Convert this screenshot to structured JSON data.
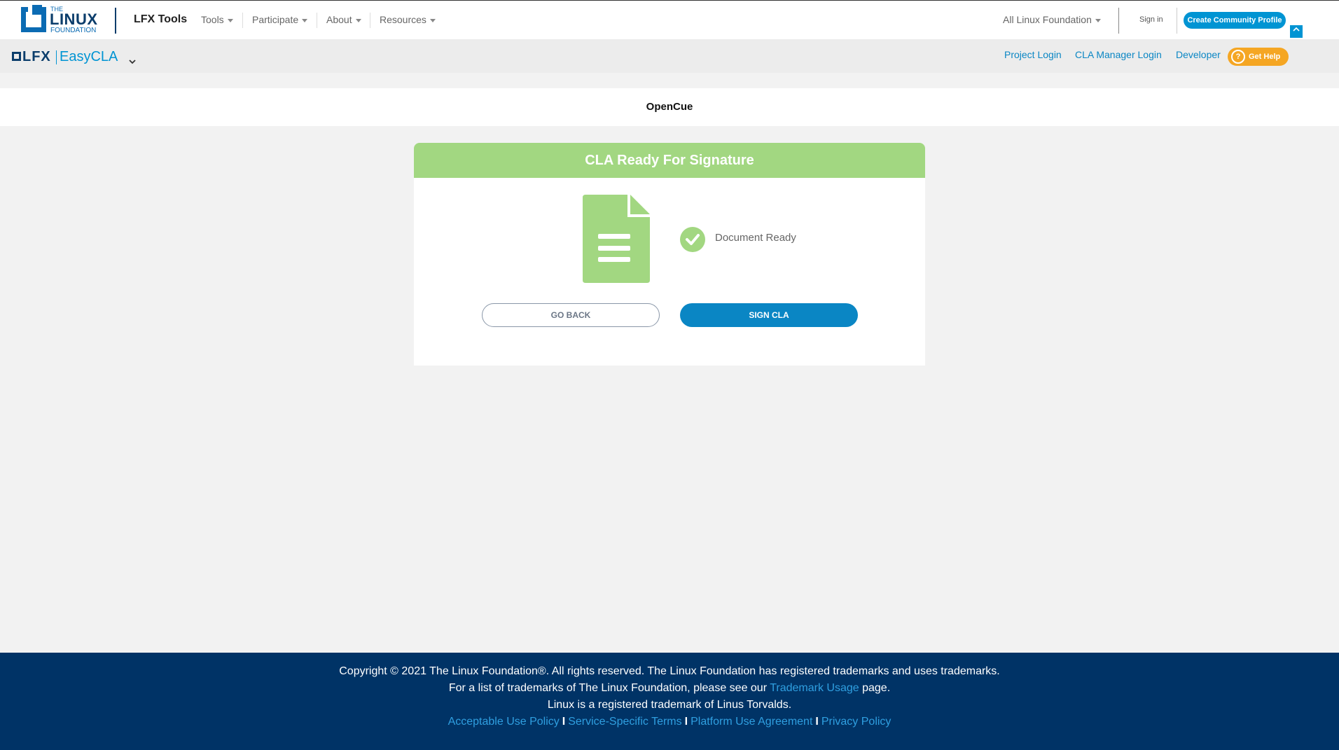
{
  "topbar": {
    "logo": {
      "the": "THE",
      "linux": "LINUX",
      "foundation": "FOUNDATION"
    },
    "product": "LFX Tools",
    "nav": [
      {
        "label": "Tools"
      },
      {
        "label": "Participate"
      },
      {
        "label": "About"
      },
      {
        "label": "Resources"
      }
    ],
    "org_selector": "All Linux Foundation",
    "sign_in": "Sign in",
    "create_profile": "Create Community Profile",
    "collapse_icon": "chevron-up-icon"
  },
  "subbar": {
    "logo": {
      "lfx": "LFX",
      "product": "EasyCLA"
    },
    "dropdown_icon": "chevron-down-icon",
    "links": [
      "Project Login",
      "CLA Manager Login",
      "Developer"
    ],
    "help": "Get Help",
    "help_icon": "question-circle-icon"
  },
  "project": {
    "name": "OpenCue"
  },
  "card": {
    "title": "CLA Ready For Signature",
    "doc_icon": "document-icon",
    "status_icon": "check-circle-icon",
    "status": "Document Ready",
    "go_back": "GO BACK",
    "sign": "SIGN CLA"
  },
  "footer": {
    "line1": "Copyright © 2021 The Linux Foundation®. All rights reserved. The Linux Foundation has registered trademarks and uses trademarks.",
    "line2_pre": "For a list of trademarks of The Linux Foundation, please see our",
    "line2_link": "Trademark Usage",
    "line2_post": "page.",
    "line3": "Linux is a registered trademark of Linus Torvalds.",
    "links": [
      "Acceptable Use Policy",
      "Service-Specific Terms",
      "Platform Use Agreement",
      "Privacy Policy"
    ],
    "separator": "I"
  },
  "colors": {
    "accent": "#0094d3",
    "header_green": "#a2d781",
    "footer_bg": "#003366",
    "help_orange": "#f5a623"
  }
}
